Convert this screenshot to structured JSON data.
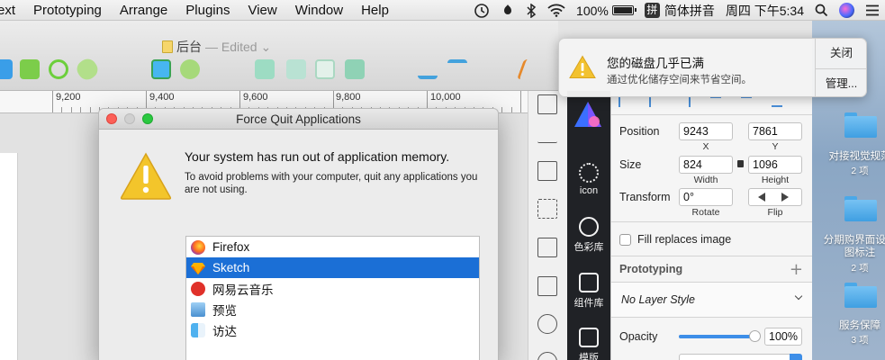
{
  "menubar": {
    "items": [
      "ext",
      "Prototyping",
      "Arrange",
      "Plugins",
      "View",
      "Window",
      "Help"
    ],
    "status": {
      "battery": "100%",
      "input_method_badge": "拼",
      "input_method": "简体拼音",
      "clock": "周四 下午5:34"
    }
  },
  "document": {
    "title": "后台",
    "edited": "— Edited ⌄"
  },
  "ruler": {
    "labels": [
      "9,200",
      "9,400",
      "9,600",
      "9,800",
      "10,000"
    ]
  },
  "notification": {
    "title": "您的磁盘几乎已满",
    "body": "通过优化储存空间来节省空间。",
    "close_label": "关闭",
    "manage_label": "管理..."
  },
  "force_quit": {
    "title": "Force Quit Applications",
    "heading": "Your system has run out of application memory.",
    "body": "To avoid problems with your computer, quit any applications you are not using.",
    "apps": [
      {
        "name": "Firefox",
        "icon": "firefox-icon",
        "selected": false
      },
      {
        "name": "Sketch",
        "icon": "sketch-icon",
        "selected": true
      },
      {
        "name": "网易云音乐",
        "icon": "netease-music-icon",
        "selected": false
      },
      {
        "name": "预览",
        "icon": "preview-icon",
        "selected": false
      },
      {
        "name": "访达",
        "icon": "finder-icon",
        "selected": false
      }
    ]
  },
  "plugins": {
    "items": [
      {
        "label": "icon",
        "icon": "icon-plugin-icon"
      },
      {
        "label": "色彩库",
        "icon": "palette-icon"
      },
      {
        "label": "组件库",
        "icon": "components-icon"
      },
      {
        "label": "模版",
        "icon": "template-icon"
      }
    ]
  },
  "inspector": {
    "position_label": "Position",
    "x_value": "9243",
    "y_value": "7861",
    "x_label": "X",
    "y_label": "Y",
    "size_label": "Size",
    "width_value": "824",
    "height_value": "1096",
    "width_label": "Width",
    "height_label": "Height",
    "transform_label": "Transform",
    "rotate_value": "0°",
    "rotate_label": "Rotate",
    "flip_label": "Flip",
    "fill_replaces_label": "Fill replaces image",
    "prototyping_label": "Prototyping",
    "layer_style": "No Layer Style",
    "opacity_label": "Opacity",
    "opacity_value": "100%",
    "opacity": 1.0
  },
  "desktop": {
    "folders": [
      {
        "name": "对接视觉规范",
        "count": "2 项"
      },
      {
        "name": "分期购界面设计图标注",
        "count": "2 项"
      },
      {
        "name": "服务保障",
        "count": "3 项"
      }
    ]
  },
  "colors": {
    "selection": "#1b6fd6",
    "plugin_bar": "#202226",
    "warning": "#f2c230"
  }
}
